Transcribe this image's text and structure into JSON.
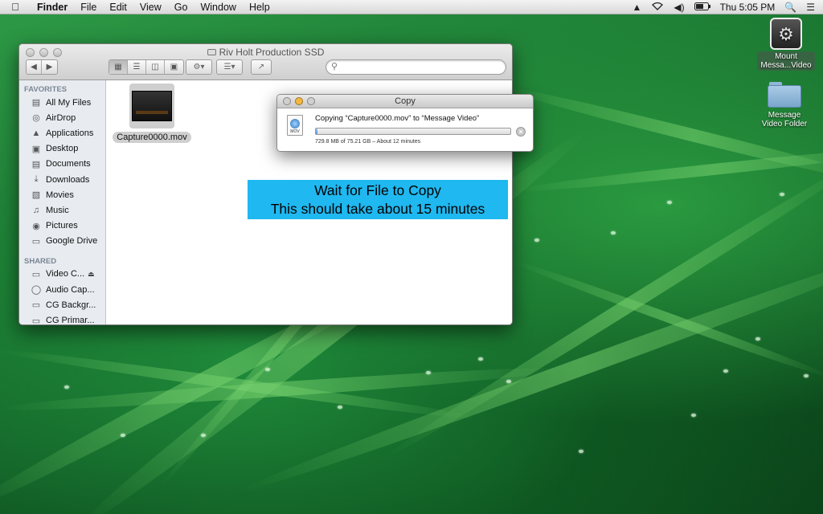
{
  "menubar": {
    "app_name": "Finder",
    "menus": [
      "File",
      "Edit",
      "View",
      "Go",
      "Window",
      "Help"
    ],
    "clock": "Thu 5:05 PM",
    "status_icons": [
      "google-drive-icon",
      "wifi-icon",
      "volume-icon",
      "battery-icon",
      "spotlight-icon",
      "notification-list-icon"
    ]
  },
  "desktop": {
    "icons": [
      {
        "label_line1": "Mount",
        "label_line2": "Messa...Video",
        "icon": "automator-app-icon"
      },
      {
        "label_line1": "Message",
        "label_line2": "Video Folder",
        "icon": "folder-icon"
      }
    ]
  },
  "finder": {
    "title": "Riv Holt Production SSD",
    "sidebar": {
      "favorites_header": "FAVORITES",
      "favorites": [
        {
          "label": "All My Files",
          "icon": "all-files-icon"
        },
        {
          "label": "AirDrop",
          "icon": "airdrop-icon"
        },
        {
          "label": "Applications",
          "icon": "applications-icon"
        },
        {
          "label": "Desktop",
          "icon": "desktop-icon"
        },
        {
          "label": "Documents",
          "icon": "documents-icon"
        },
        {
          "label": "Downloads",
          "icon": "downloads-icon"
        },
        {
          "label": "Movies",
          "icon": "movies-icon"
        },
        {
          "label": "Music",
          "icon": "music-icon"
        },
        {
          "label": "Pictures",
          "icon": "pictures-icon"
        },
        {
          "label": "Google Drive",
          "icon": "folder-icon"
        }
      ],
      "shared_header": "SHARED",
      "shared": [
        {
          "label": "Video C...",
          "icon": "display-icon",
          "eject": true
        },
        {
          "label": "Audio Cap...",
          "icon": "server-icon",
          "eject": false
        },
        {
          "label": "CG Backgr...",
          "icon": "display-icon",
          "eject": false
        },
        {
          "label": "CG Primar...",
          "icon": "display-icon",
          "eject": false
        }
      ]
    },
    "files": [
      {
        "name": "Capture0000.mov"
      }
    ]
  },
  "copy_dialog": {
    "title": "Copy",
    "message": "Copying “Capture0000.mov” to “Message Video”",
    "detail": "729.8 MB of 75.21 GB – About 12 minutes",
    "file_badge": "MOV",
    "progress": 0.01
  },
  "annotation": {
    "line1": "Wait for File to Copy",
    "line2": "This should take about 15 minutes",
    "color": "#1fb8f0"
  }
}
